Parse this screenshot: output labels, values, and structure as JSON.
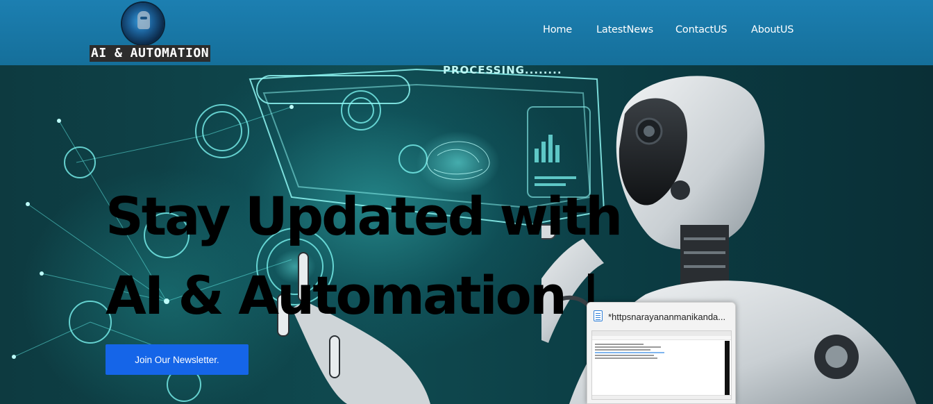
{
  "brand": {
    "name": "AI & AUTOMATION",
    "logo_icon": "robot-logo-icon"
  },
  "nav": {
    "items": [
      {
        "label": "Home"
      },
      {
        "label": "LatestNews"
      },
      {
        "label": "ContactUS"
      },
      {
        "label": "AboutUS"
      }
    ]
  },
  "hero": {
    "headline_line1": "Stay Updated with",
    "headline_line2": "AI & Automation |",
    "overlay_text": "PROCESSING........",
    "cta_label": "Join Our Newsletter."
  },
  "taskbar_preview": {
    "title": "*httpsnarayananmanikanda...",
    "icon": "notepad-icon"
  },
  "colors": {
    "header": "#1c7fb1",
    "cta": "#1565e8",
    "hero_glow": "#3cc8c8"
  }
}
